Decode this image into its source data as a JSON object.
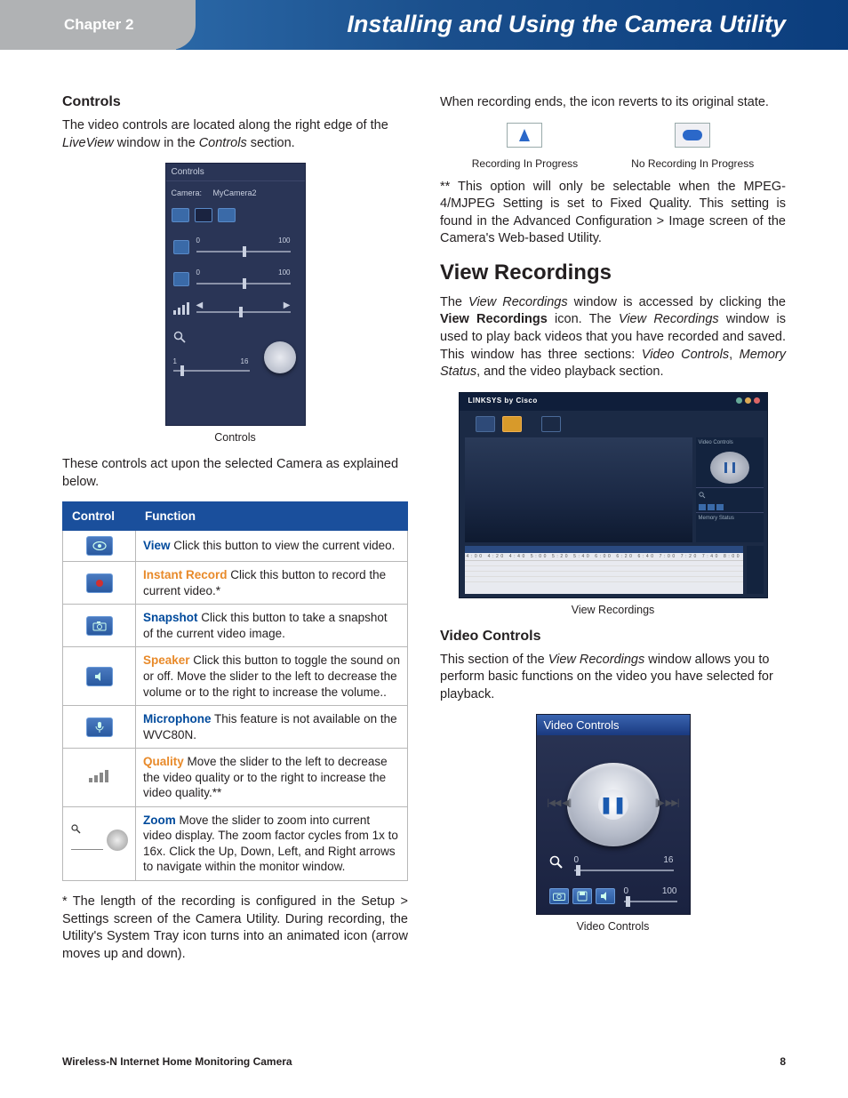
{
  "header": {
    "chapter": "Chapter 2",
    "title": "Installing and Using the Camera Utility"
  },
  "left": {
    "h_controls": "Controls",
    "intro": "The video controls are located along the right edge of the LiveView window in the Controls section.",
    "fig_controls": {
      "panel_title": "Controls",
      "camera_label": "Camera:",
      "camera_value": "MyCamera2",
      "slider_min": "0",
      "slider_max": "100",
      "zoom_min": "1",
      "zoom_max": "16"
    },
    "fig_controls_caption": "Controls",
    "explain": "These controls act upon the selected Camera as explained below.",
    "table": {
      "th_control": "Control",
      "th_function": "Function",
      "rows": [
        {
          "label": "View",
          "text": " Click this button to view the current video."
        },
        {
          "label": "Instant Record",
          "text": " Click this button to record the current video.*"
        },
        {
          "label": "Snapshot",
          "text": " Click this button to take a snapshot of the current video image."
        },
        {
          "label": "Speaker",
          "text": "  Click this button to toggle the sound on or off. Move the slider to the left to decrease the volume or to the right to increase the volume.."
        },
        {
          "label": "Microphone",
          "text": "   This feature is not available on the WVC80N."
        },
        {
          "label": "Quality",
          "text": "  Move the slider to the left to decrease the video quality or to the right to increase the video quality.**"
        },
        {
          "label": "Zoom",
          "text": "  Move the slider to zoom into current video display. The zoom factor cycles from 1x to 16x. Click the Up, Down, Left, and Right arrows to navigate within the monitor window."
        }
      ]
    },
    "footnote1": "*  The  length  of  the  recording  is  configured  in  the Setup  >  Settings  screen  of  the  Camera  Utility.  During recording,  the  Utility's  System  Tray  icon  turns  into  an animated icon (arrow moves up and down)."
  },
  "right": {
    "recording_line": "When recording ends, the icon reverts to its original state.",
    "rec_cap1": "Recording In Progress",
    "rec_cap2": "No Recording In Progress",
    "footnote2": "** This option will only be selectable when the MPEG-4/MJPEG Setting is set to Fixed Quality. This setting is found in  the  Advanced  Configuration  >  Image  screen  of  the Camera's Web-based Utility.",
    "h_view": "View Recordings",
    "view_text_pre": "The ",
    "view_text_i1": "View Recordings",
    "view_text_mid1": " window is accessed by clicking the ",
    "view_text_b": "View Recordings",
    "view_text_mid2": " icon. The ",
    "view_text_i2": "View Recordings",
    "view_text_mid3": " window is used to play back videos that you have recorded and saved. This window has three sections: ",
    "view_text_i3": "Video Controls",
    "view_text_mid4": ", ",
    "view_text_i4": "Memory Status",
    "view_text_end": ", and the video playback section.",
    "fig_view": {
      "logo": "LINKSYS by Cisco",
      "side_label": "Video Controls",
      "mem_label": "Memory Status",
      "timeline_scale": "4:00 4:20 4:40 5:00 5:20 5:40 6:00 6:20 6:40 7:00 7:20 7:40 8:00"
    },
    "fig_view_caption": "View Recordings",
    "h_vc": "Video Controls",
    "vc_text_pre": "This section of the ",
    "vc_text_i": "View Recordings",
    "vc_text_end": " window allows you to perform basic functions on the video you have selected for playback.",
    "fig_vc": {
      "title": "Video Controls",
      "z_min": "0",
      "z_max": "16",
      "v_min": "0",
      "v_max": "100"
    },
    "fig_vc_caption": "Video Controls"
  },
  "footer": {
    "product": "Wireless-N Internet Home Monitoring Camera",
    "page": "8"
  }
}
